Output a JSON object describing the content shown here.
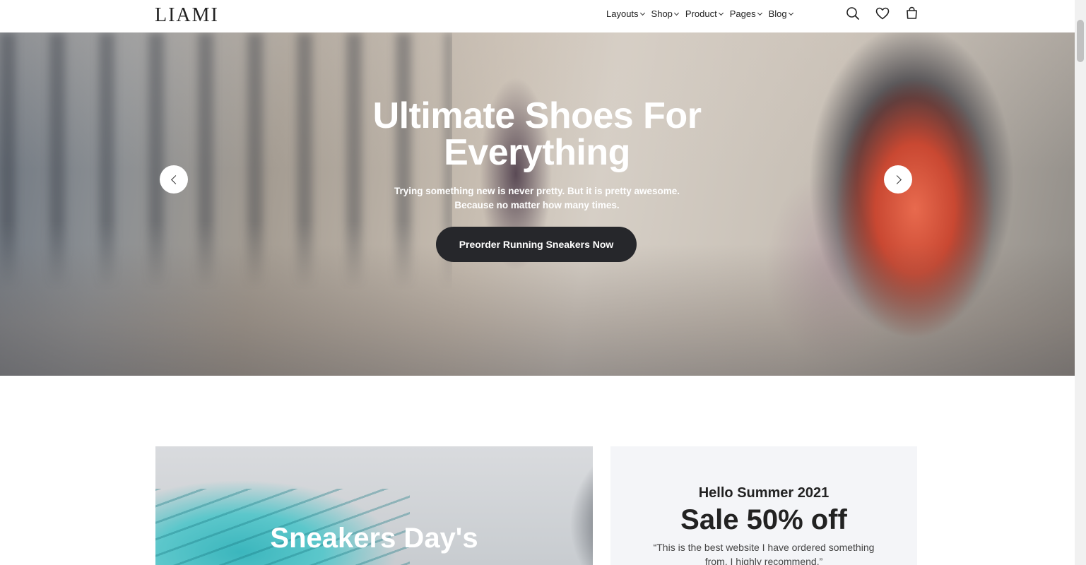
{
  "header": {
    "logo": "LIAMI",
    "nav": [
      {
        "label": "Layouts"
      },
      {
        "label": "Shop"
      },
      {
        "label": "Product"
      },
      {
        "label": "Pages"
      },
      {
        "label": "Blog"
      }
    ],
    "icons": [
      "search-icon",
      "heart-icon",
      "shopping-bag-icon"
    ]
  },
  "hero": {
    "title_line1": "Ultimate Shoes For",
    "title_line2": "Everything",
    "subtitle_line1": "Trying something new is never pretty. But it is pretty awesome.",
    "subtitle_line2": "Because no matter how many times.",
    "cta_label": "Preorder Running Sneakers Now"
  },
  "banners": {
    "left_title": "Sneakers Day's",
    "right_small": "Hello Summer 2021",
    "right_big": "Sale 50% off",
    "right_quote": "“This is the best website I have ordered something from. I highly recommend.”"
  },
  "colors": {
    "dark_button": "#26272b",
    "banner_right_bg": "#f4f5f8"
  }
}
